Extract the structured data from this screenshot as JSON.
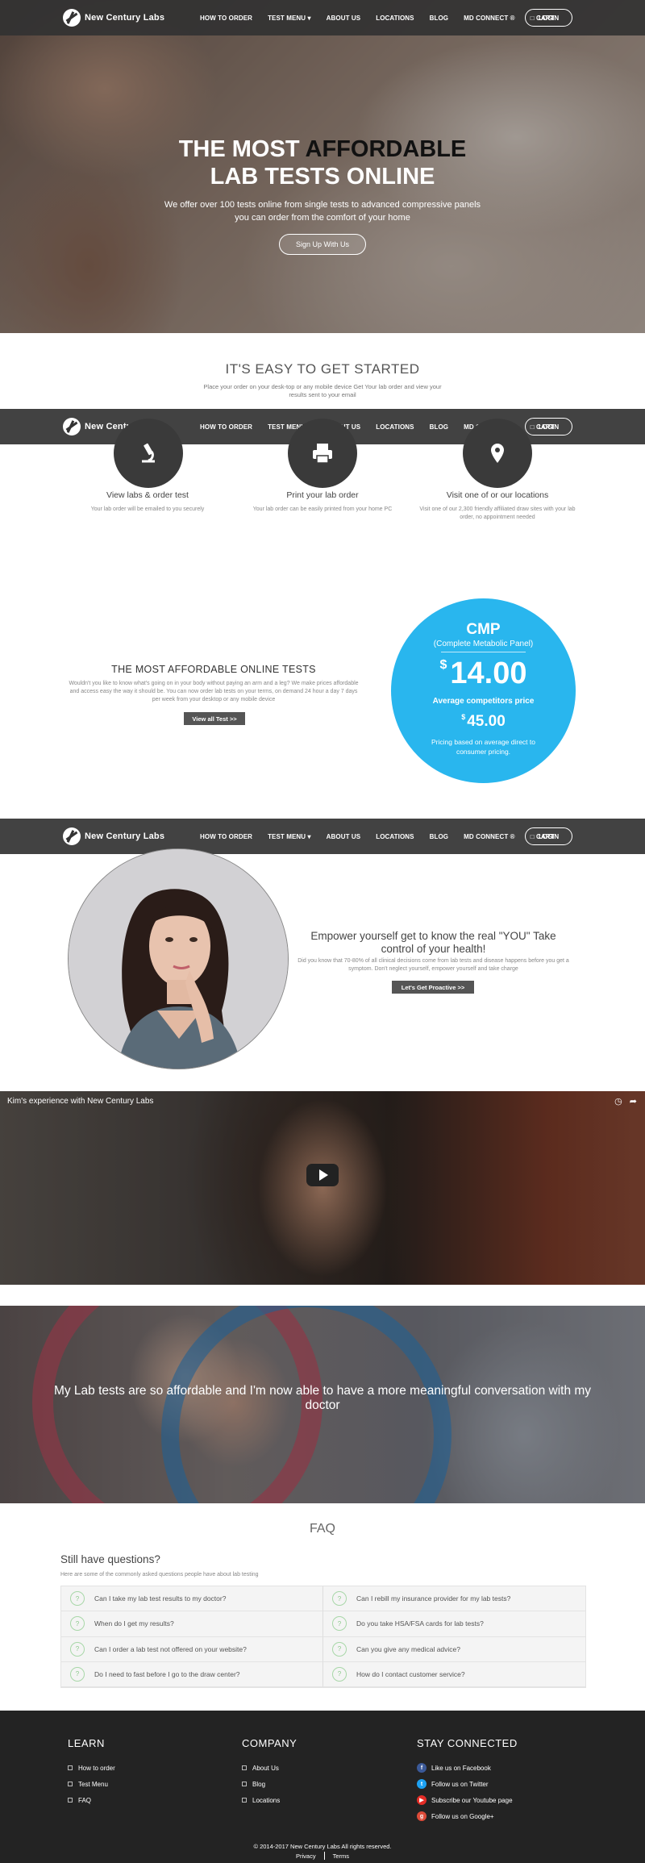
{
  "nav": {
    "brand": "New Century Labs",
    "links": [
      "HOW TO ORDER",
      "TEST MENU ▾",
      "ABOUT US",
      "LOCATIONS",
      "BLOG",
      "MD CONNECT ®",
      "□ CART"
    ],
    "login": "LOGIN"
  },
  "hero": {
    "title_part1": "THE MOST ",
    "title_dark": "AFFORDABLE",
    "title_line2": "LAB TESTS ONLINE",
    "subtitle": "We offer over 100 tests online from single tests to advanced compressive panels you can order from the comfort of your home",
    "cta": "Sign Up With Us"
  },
  "getting_started": {
    "title": "IT'S EASY TO GET STARTED",
    "subtitle": "Place your order on your desk-top or any mobile device Get Your lab order and view your results sent to your email",
    "steps": [
      {
        "icon": "microscope-icon",
        "title": "View labs & order test",
        "desc": "Your lab order will be emailed to you securely"
      },
      {
        "icon": "printer-icon",
        "title": "Print your lab order",
        "desc": "Your lab order can be easily printed from your home PC"
      },
      {
        "icon": "location-pin-icon",
        "title": "Visit one of or our locations",
        "desc": "Visit one of our 2,300 friendly affiliated draw sites with your lab order, no appointment needed"
      }
    ]
  },
  "affordable": {
    "title": "THE MOST AFFORDABLE ONLINE TESTS",
    "text": "Wouldn't you like to know what's going on in your body without paying an arm and a leg? We make prices affordable and access easy the way it should be. You can now order lab tests on your terms, on demand 24 hour a day 7 days per week from your desktop or any mobile device",
    "button": "View all Test >>"
  },
  "cmp": {
    "name": "CMP",
    "full_name": "(Complete Metabolic Panel)",
    "currency": "$",
    "price": "14.00",
    "avg_label": "Average competitors price",
    "avg_price": "45.00",
    "note": "Pricing based on average direct to consumer pricing."
  },
  "empower": {
    "title": "Empower yourself get to know the real \"YOU\" Take control of your health!",
    "text": "Did you know that 70-80% of all clinical decisions come from lab tests and disease happens before you get a symptom. Don't neglect yourself, empower yourself and take charge",
    "button": "Let's Get Proactive >>"
  },
  "video": {
    "title": "Kim's experience with New Century Labs",
    "icons": [
      "clock-icon",
      "share-icon"
    ]
  },
  "testimonial": {
    "quote": "My Lab tests are so affordable and I'm now able to have a more meaningful conversation with my doctor"
  },
  "faq": {
    "title": "FAQ",
    "heading": "Still have questions?",
    "subtitle": "Here are some of the commonly asked questions people have about lab testing",
    "items": [
      "Can I take my lab test results to my doctor?",
      "Can I rebill my insurance provider for my lab tests?",
      "When do I get my results?",
      "Do you take HSA/FSA cards for lab tests?",
      "Can I order a lab test not offered on your website?",
      "Can you give any medical advice?",
      "Do I need to fast before I go to the draw center?",
      "How do I contact customer service?"
    ]
  },
  "footer": {
    "learn_title": "LEARN",
    "learn": [
      "How to order",
      "Test Menu",
      "FAQ"
    ],
    "company_title": "COMPANY",
    "company": [
      "About Us",
      "Blog",
      "Locations"
    ],
    "connect_title": "STAY CONNECTED",
    "connect": [
      {
        "label": "Like us on Facebook",
        "color": "#3b5998",
        "glyph": "f"
      },
      {
        "label": "Follow us on Twitter",
        "color": "#1da1f2",
        "glyph": "t"
      },
      {
        "label": "Subscribe our Youtube page",
        "color": "#e52d27",
        "glyph": "▶"
      },
      {
        "label": "Follow us on Google+",
        "color": "#dd4b39",
        "glyph": "g"
      }
    ],
    "copyright": "© 2014-2017 New Century Labs All rights reserved.",
    "privacy": "Privacy",
    "terms": "Terms"
  },
  "colors": {
    "accent_blue": "#29b6ee",
    "nav_bg": "#323232",
    "footer_bg": "#232323"
  }
}
